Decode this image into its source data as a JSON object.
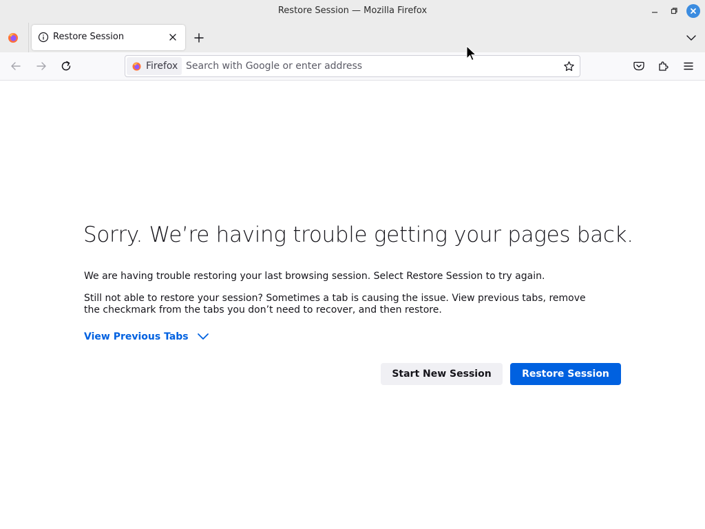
{
  "window": {
    "title": "Restore Session — Mozilla Firefox"
  },
  "tabs": [
    {
      "label": "Restore Session",
      "icon": "info-icon"
    }
  ],
  "navbar": {
    "identity_label": "Firefox",
    "url_placeholder": "Search with Google or enter address",
    "url_value": ""
  },
  "content": {
    "heading": "Sorry. We’re having trouble getting your pages back.",
    "paragraph1": "We are having trouble restoring your last browsing session. Select Restore Session to try again.",
    "paragraph2": "Still not able to restore your session? Sometimes a tab is causing the issue. View previous tabs, remove the checkmark from the tabs you don’t need to recover, and then restore.",
    "view_previous_tabs": "View Previous Tabs",
    "start_new_session_button": "Start New Session",
    "restore_session_button": "Restore Session"
  },
  "colors": {
    "accent": "#0061e0",
    "window_chrome": "#ececec",
    "close_button": "#3b8ce0"
  }
}
